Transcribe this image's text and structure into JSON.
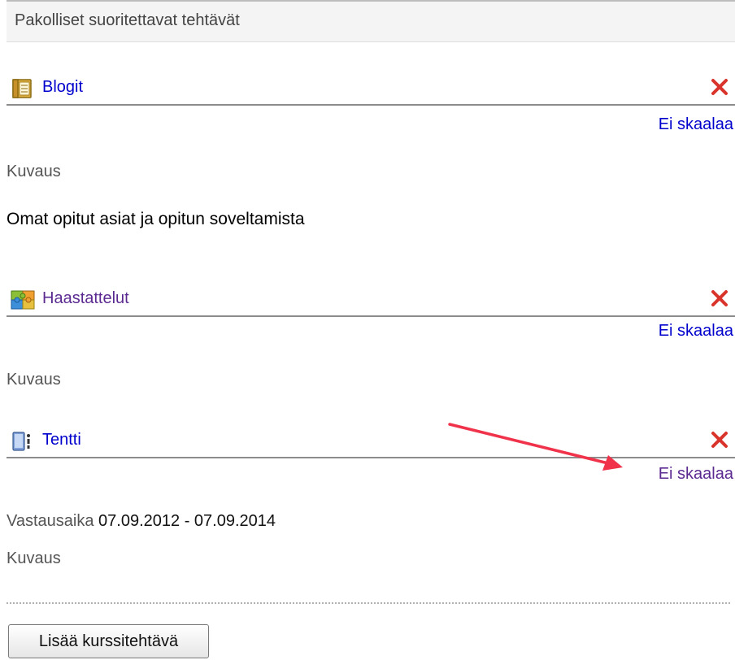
{
  "section": {
    "title": "Pakolliset suoritettavat tehtävät"
  },
  "tasks": [
    {
      "icon": "blog-book-icon",
      "title": "Blogit",
      "scale": "Ei skaalaa",
      "description_label": "Kuvaus",
      "description": "Omat opitut asiat ja opitun soveltamista"
    },
    {
      "icon": "interview-puzzle-icon",
      "title": "Haastattelut",
      "scale": "Ei skaalaa",
      "description_label": "Kuvaus"
    },
    {
      "icon": "exam-device-icon",
      "title": "Tentti",
      "scale": "Ei skaalaa",
      "answer_time_label": "Vastausaika",
      "answer_time": "07.09.2012 - 07.09.2014",
      "description_label": "Kuvaus"
    }
  ],
  "add_button_label": "Lisää kurssitehtävä",
  "colors": {
    "link": "#0000cc",
    "visited_link": "#5b2a91",
    "delete": "#d9342b",
    "annotation_arrow": "#f0334a"
  }
}
